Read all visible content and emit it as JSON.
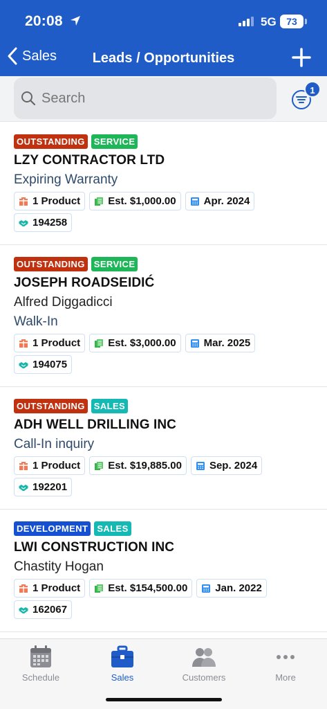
{
  "status": {
    "time": "20:08",
    "network": "5G",
    "battery": "73"
  },
  "nav": {
    "back_label": "Sales",
    "title": "Leads / Opportunities"
  },
  "search": {
    "placeholder": "Search",
    "filter_count": "1"
  },
  "colors": {
    "header": "#1f5cc7",
    "outstanding": "#c0320f",
    "development": "#1550d3",
    "service": "#1fb65a",
    "sales": "#15b9b3"
  },
  "leads": [
    {
      "tags": [
        {
          "text": "OUTSTANDING",
          "color": "#c0320f"
        },
        {
          "text": "SERVICE",
          "color": "#1fb65a"
        }
      ],
      "company": "LZY CONTRACTOR LTD",
      "contact": "",
      "source": "Expiring Warranty",
      "products": "1 Product",
      "estimate": "Est. $1,000.00",
      "date": "Apr. 2024",
      "id": "194258"
    },
    {
      "tags": [
        {
          "text": "OUTSTANDING",
          "color": "#c0320f"
        },
        {
          "text": "SERVICE",
          "color": "#1fb65a"
        }
      ],
      "company": "JOSEPH ROADSEIDIĆ",
      "contact": "Alfred Diggadicci",
      "source": "Walk-In",
      "products": "1 Product",
      "estimate": "Est. $3,000.00",
      "date": "Mar. 2025",
      "id": "194075"
    },
    {
      "tags": [
        {
          "text": "OUTSTANDING",
          "color": "#c0320f"
        },
        {
          "text": "SALES",
          "color": "#15b9b3"
        }
      ],
      "company": "ADH WELL DRILLING INC",
      "contact": "",
      "source": "Call-In inquiry",
      "products": "1 Product",
      "estimate": "Est. $19,885.00",
      "date": "Sep. 2024",
      "id": "192201"
    },
    {
      "tags": [
        {
          "text": "DEVELOPMENT",
          "color": "#1550d3"
        },
        {
          "text": "SALES",
          "color": "#15b9b3"
        }
      ],
      "company": "LWI CONSTRUCTION INC",
      "contact": "Chastity Hogan",
      "source": "",
      "products": "1 Product",
      "estimate": "Est. $154,500.00",
      "date": "Jan. 2022",
      "id": "162067"
    }
  ],
  "tabs": [
    {
      "label": "Schedule",
      "icon": "calendar-icon"
    },
    {
      "label": "Sales",
      "icon": "briefcase-icon"
    },
    {
      "label": "Customers",
      "icon": "people-icon"
    },
    {
      "label": "More",
      "icon": "more-dots-icon"
    }
  ]
}
